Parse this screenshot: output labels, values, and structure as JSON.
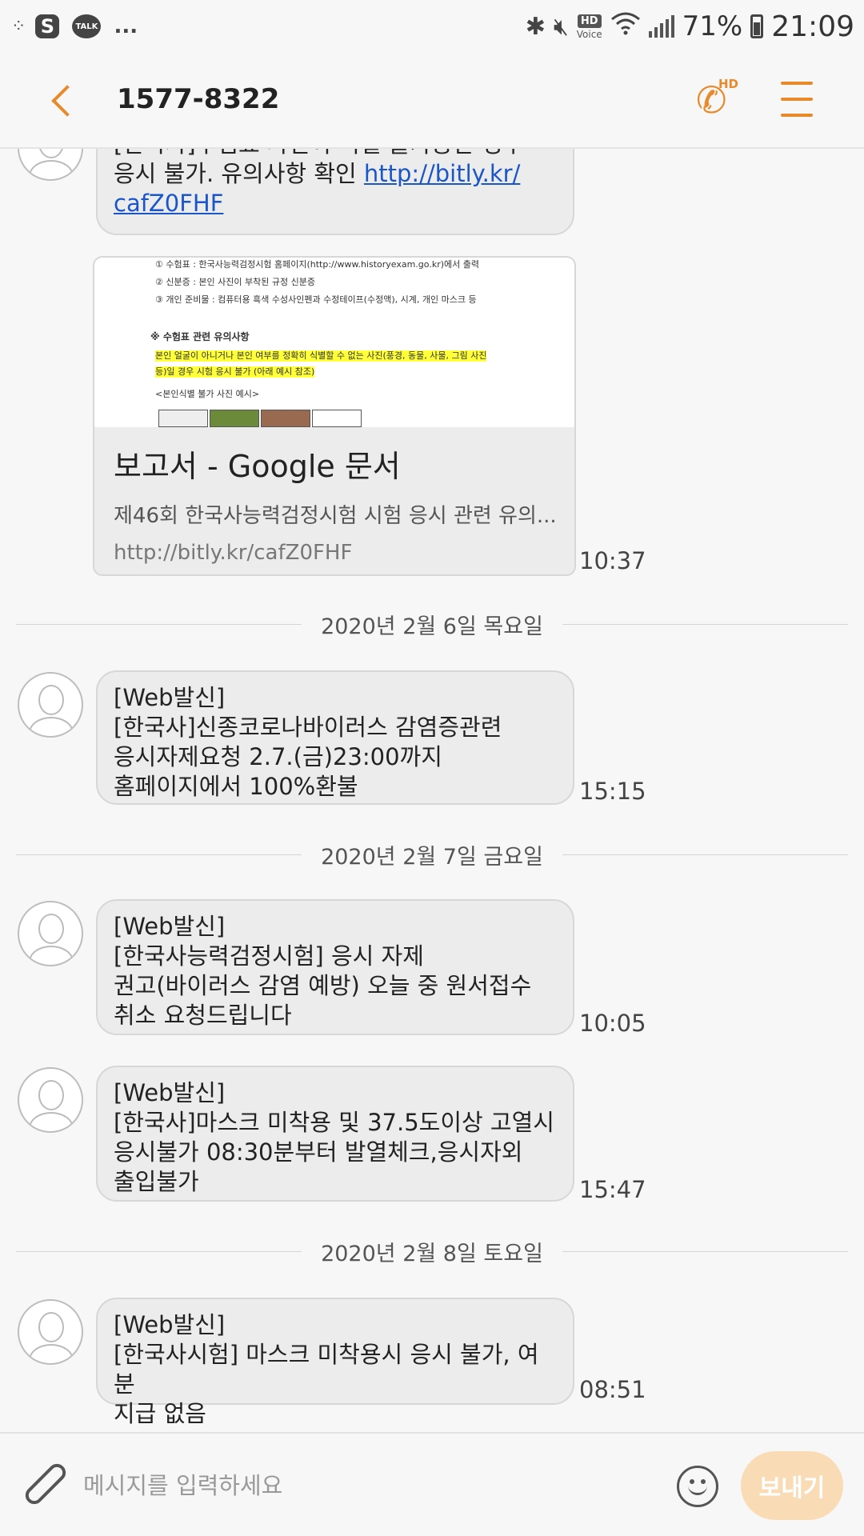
{
  "status_bar": {
    "battery_percent": "71%",
    "time": "21:09",
    "hd_label": "HD",
    "voice_label": "Voice",
    "talk_label": "TALK",
    "s_label": "S",
    "more_label": "..."
  },
  "header": {
    "title": "1577-8322",
    "call_hd_label": "HD"
  },
  "messages": [
    {
      "text": "[한국사]수험표 사진이 식별 불가능한 경우\n응시 불가. 유의사항 확인 ",
      "link": "http://bitly.kr/\ncafZ0FHF",
      "preview": {
        "doc_lines": [
          "① 수험표 : 한국사능력검정시험 홈페이지(http://www.historyexam.go.kr)에서 출력",
          "② 신분증 : 본인 사진이 부착된 규정 신분증",
          "③ 개인 준비물 : 컴퓨터용 흑색 수성사인펜과 수정테이프(수정액), 시계, 개인 마스크 등",
          "※ 수험표 관련 유의사항",
          "본인 얼굴이 아니거나 본인 여부를 정확히 식별할 수 없는 사진(풍경, 동물, 사물, 그림 사진",
          "등)일 경우 시험 응시 불가 (아래 예시 참조)",
          "<본인식별 불가 사진 예시>"
        ],
        "title": "보고서 - Google 문서",
        "description": "제46회 한국사능력검정시험 시험 응시 관련 유의...",
        "url": "http://bitly.kr/cafZ0FHF"
      },
      "time": "10:37"
    },
    {
      "date": "2020년 2월 6일 목요일"
    },
    {
      "text": "[Web발신]\n[한국사]신종코로나바이러스 감염증관련\n응시자제요청 2.7.(금)23:00까지\n홈페이지에서 100%환불",
      "time": "15:15"
    },
    {
      "date": "2020년 2월 7일 금요일"
    },
    {
      "text": "[Web발신]\n[한국사능력검정시험] 응시 자제\n권고(바이러스 감염 예방) 오늘 중 원서접수\n취소 요청드립니다",
      "time": "10:05"
    },
    {
      "text": "[Web발신]\n[한국사]마스크 미착용 및 37.5도이상 고열시\n응시불가 08:30분부터 발열체크,응시자외\n출입불가",
      "time": "15:47"
    },
    {
      "date": "2020년 2월 8일 토요일"
    },
    {
      "text": "[Web발신]\n[한국사시험] 마스크 미착용시 응시 불가, 여분\n지급 없음",
      "time": "08:51"
    }
  ],
  "compose": {
    "placeholder": "메시지를 입력하세요",
    "send_label": "보내기"
  },
  "colors": {
    "accent": "#e88a2c",
    "bubble": "#ececec",
    "send_disabled": "#f9dcb6",
    "link": "#1b56c9"
  }
}
